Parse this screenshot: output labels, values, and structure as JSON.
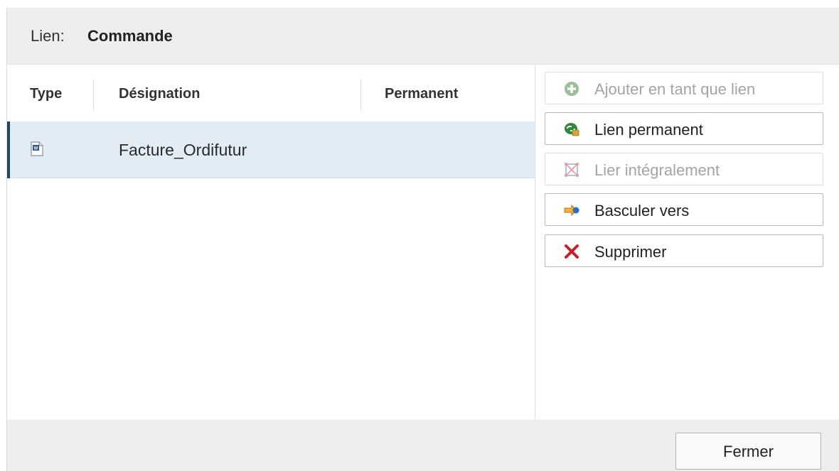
{
  "header": {
    "label": "Lien:",
    "value": "Commande"
  },
  "table": {
    "columns": [
      "Type",
      "Désignation",
      "Permanent"
    ],
    "rows": [
      {
        "type_icon": "word-document-icon",
        "designation": "Facture_Ordifutur",
        "permanent": ""
      }
    ]
  },
  "actions": [
    {
      "label": "Ajouter en tant que lien",
      "icon": "add-circle-icon",
      "enabled": false
    },
    {
      "label": "Lien permanent",
      "icon": "permanent-link-icon",
      "enabled": true
    },
    {
      "label": "Lier intégralement",
      "icon": "link-all-icon",
      "enabled": false
    },
    {
      "label": "Basculer vers",
      "icon": "switch-to-arrow-icon",
      "enabled": true
    },
    {
      "label": "Supprimer",
      "icon": "delete-x-icon",
      "enabled": true
    }
  ],
  "footer": {
    "close_label": "Fermer"
  },
  "colors": {
    "selection_row": "#e2ecf4",
    "selection_marker": "#20466e",
    "add_green": "#3a9a3a",
    "delete_red": "#c8202a",
    "link_icon_pink": "#d97a8a",
    "switch_arrow_orange": "#f0a020"
  }
}
